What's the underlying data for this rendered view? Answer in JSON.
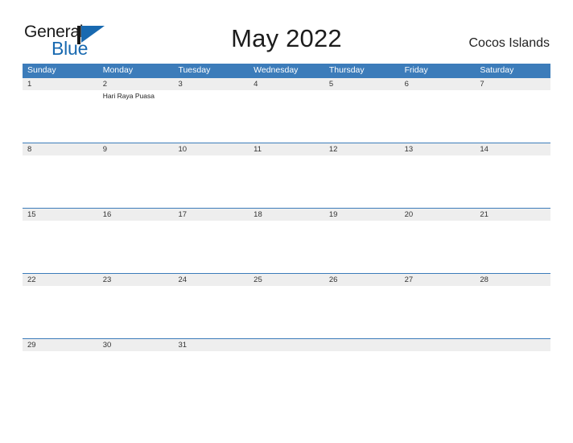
{
  "brand": {
    "name_part1": "General",
    "name_part2": "Blue",
    "flag_icon": "blue-flag-triangle-icon",
    "accent_color": "#1869b0"
  },
  "header": {
    "title": "May 2022",
    "region": "Cocos Islands"
  },
  "colors": {
    "header_blue": "#3c7cba",
    "day_band_gray": "#eeeeee",
    "text_dark": "#1a1a1a",
    "logo_blue": "#1869b0"
  },
  "calendar": {
    "month": "May",
    "year": "2022",
    "weekday_headers": [
      "Sunday",
      "Monday",
      "Tuesday",
      "Wednesday",
      "Thursday",
      "Friday",
      "Saturday"
    ],
    "weeks": [
      {
        "days": [
          {
            "number": "1",
            "events": []
          },
          {
            "number": "2",
            "events": [
              "Hari Raya Puasa"
            ]
          },
          {
            "number": "3",
            "events": []
          },
          {
            "number": "4",
            "events": []
          },
          {
            "number": "5",
            "events": []
          },
          {
            "number": "6",
            "events": []
          },
          {
            "number": "7",
            "events": []
          }
        ]
      },
      {
        "days": [
          {
            "number": "8",
            "events": []
          },
          {
            "number": "9",
            "events": []
          },
          {
            "number": "10",
            "events": []
          },
          {
            "number": "11",
            "events": []
          },
          {
            "number": "12",
            "events": []
          },
          {
            "number": "13",
            "events": []
          },
          {
            "number": "14",
            "events": []
          }
        ]
      },
      {
        "days": [
          {
            "number": "15",
            "events": []
          },
          {
            "number": "16",
            "events": []
          },
          {
            "number": "17",
            "events": []
          },
          {
            "number": "18",
            "events": []
          },
          {
            "number": "19",
            "events": []
          },
          {
            "number": "20",
            "events": []
          },
          {
            "number": "21",
            "events": []
          }
        ]
      },
      {
        "days": [
          {
            "number": "22",
            "events": []
          },
          {
            "number": "23",
            "events": []
          },
          {
            "number": "24",
            "events": []
          },
          {
            "number": "25",
            "events": []
          },
          {
            "number": "26",
            "events": []
          },
          {
            "number": "27",
            "events": []
          },
          {
            "number": "28",
            "events": []
          }
        ]
      },
      {
        "days": [
          {
            "number": "29",
            "events": []
          },
          {
            "number": "30",
            "events": []
          },
          {
            "number": "31",
            "events": []
          },
          {
            "number": "",
            "events": []
          },
          {
            "number": "",
            "events": []
          },
          {
            "number": "",
            "events": []
          },
          {
            "number": "",
            "events": []
          }
        ]
      }
    ]
  }
}
